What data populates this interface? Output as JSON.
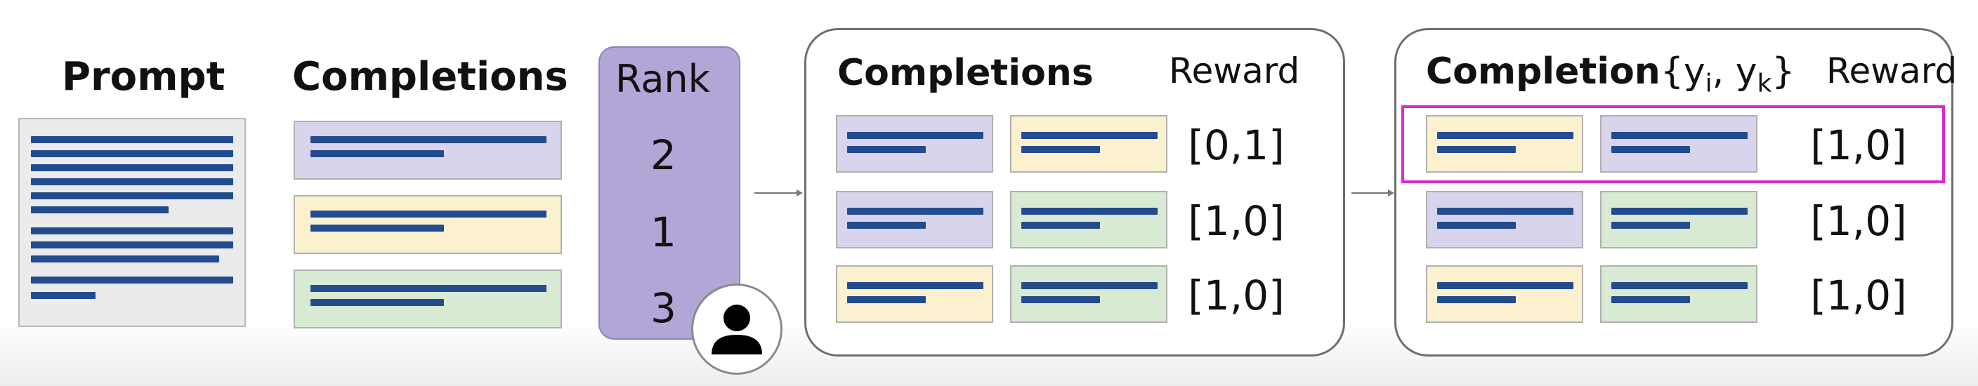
{
  "prompt_label": "Prompt",
  "completions_label": "Completions",
  "rank_label": "Rank",
  "ranks": [
    "2",
    "1",
    "3"
  ],
  "panel1": {
    "col_label": "Completions",
    "reward_label": "Reward",
    "rewards": [
      "[0,1]",
      "[1,0]",
      "[1,0]"
    ]
  },
  "panel2": {
    "col_label": "Completion",
    "pair_open": "{y",
    "sub_i": "i",
    "sep": ", y",
    "sub_k": "k",
    "pair_close": "}",
    "reward_label": "Reward",
    "rewards": [
      "[1,0]",
      "[1,0]",
      "[1,0]"
    ]
  },
  "colors": {
    "purple": "#d8d4ec",
    "yellow": "#fcf1cf",
    "green": "#d9ead4",
    "line_blue": "#234c8e",
    "rank_purple": "#b1a6d6",
    "highlight_magenta": "#d92bd2"
  },
  "icons": [
    "person-icon",
    "arrow-right-icon"
  ]
}
